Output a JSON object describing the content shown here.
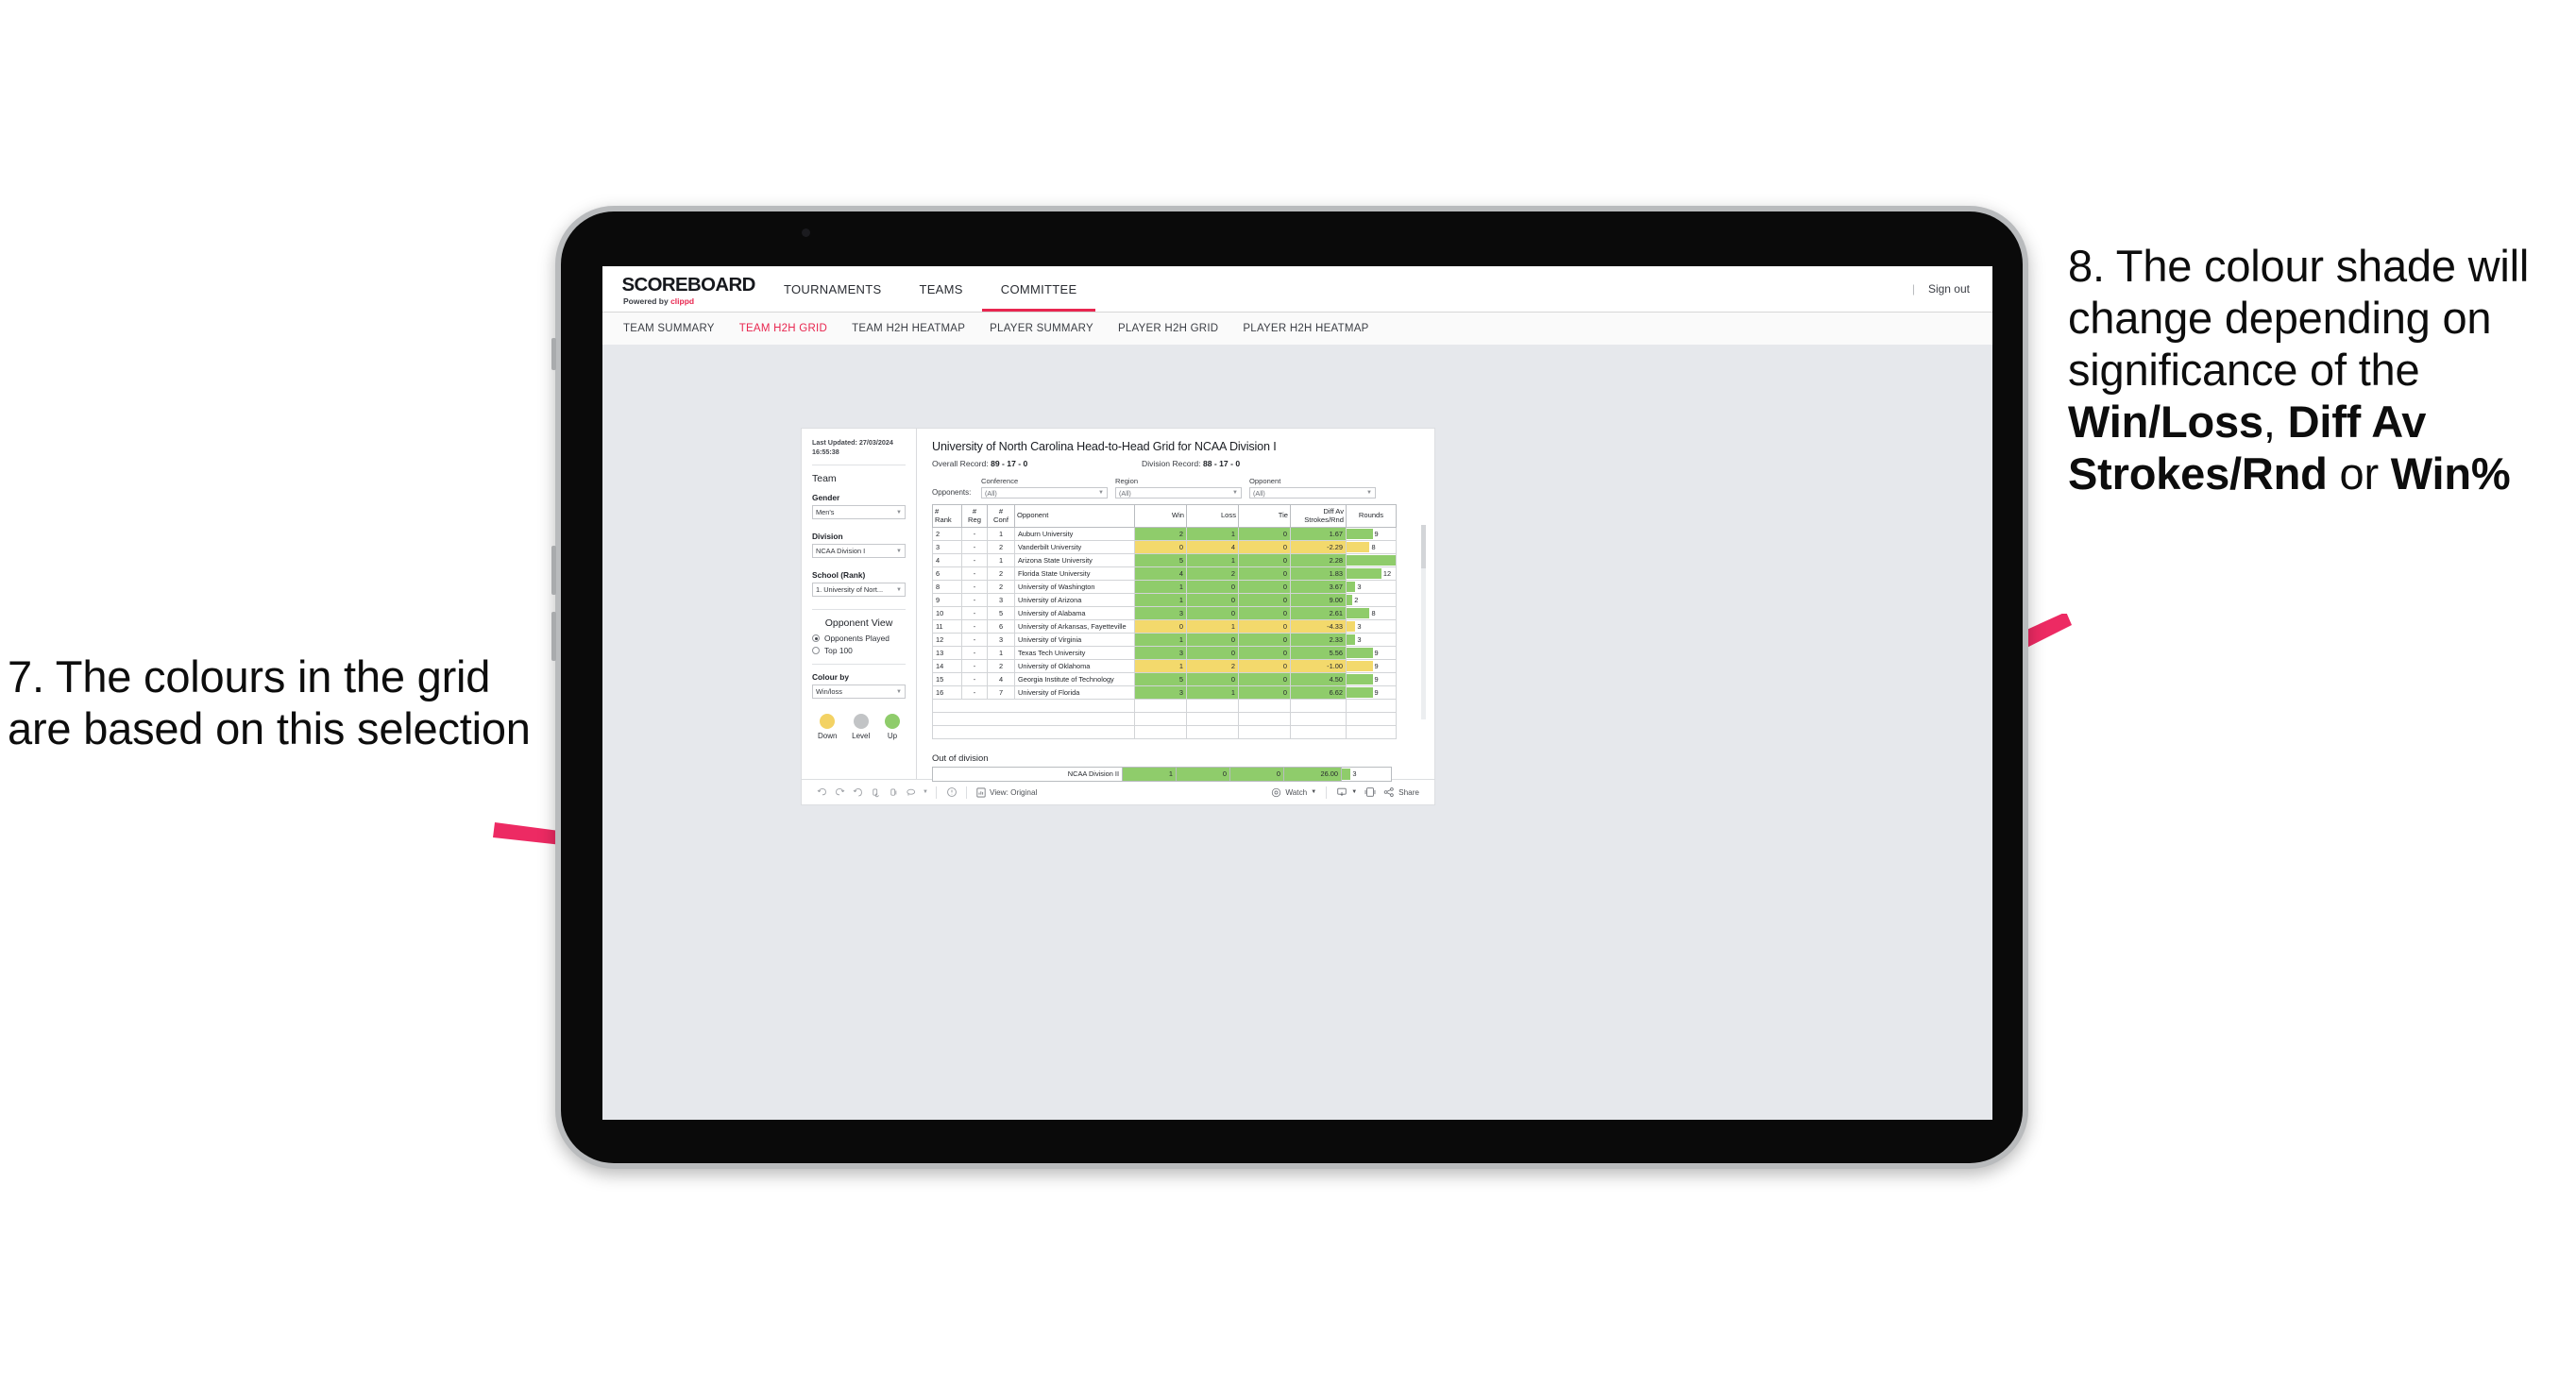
{
  "annotations": {
    "left": "7. The colours in the grid are based on this selection",
    "right_pre": "8. The colour shade will change depending on significance of the ",
    "right_b1": "Win/Loss",
    "right_mid1": ", ",
    "right_b2": "Diff Av Strokes/Rnd",
    "right_mid2": " or ",
    "right_b3": "Win%",
    "accent_color": "#ed2a63"
  },
  "topnav": {
    "brand_title": "SCOREBOARD",
    "brand_sub_prefix": "Powered by ",
    "brand_sub_name": "clippd",
    "items": [
      {
        "label": "TOURNAMENTS",
        "active": false
      },
      {
        "label": "TEAMS",
        "active": false
      },
      {
        "label": "COMMITTEE",
        "active": true
      }
    ],
    "separator": "|",
    "signout": "Sign out"
  },
  "subnav": {
    "items": [
      {
        "label": "TEAM SUMMARY",
        "active": false
      },
      {
        "label": "TEAM H2H GRID",
        "active": true
      },
      {
        "label": "TEAM H2H HEATMAP",
        "active": false
      },
      {
        "label": "PLAYER SUMMARY",
        "active": false
      },
      {
        "label": "PLAYER H2H GRID",
        "active": false
      },
      {
        "label": "PLAYER H2H HEATMAP",
        "active": false
      }
    ]
  },
  "sidebar": {
    "last_updated": "Last Updated: 27/03/2024 16:55:38",
    "team_heading": "Team",
    "gender_label": "Gender",
    "gender_value": "Men's",
    "division_label": "Division",
    "division_value": "NCAA Division I",
    "school_label": "School (Rank)",
    "school_value": "1. University of Nort...",
    "opponent_view_heading": "Opponent View",
    "opponent_view_options": [
      {
        "label": "Opponents Played",
        "selected": true
      },
      {
        "label": "Top 100",
        "selected": false
      }
    ],
    "colour_by_label": "Colour by",
    "colour_by_value": "Win/loss",
    "legend": [
      {
        "label": "Down",
        "color": "#f3d264"
      },
      {
        "label": "Level",
        "color": "#c2c4c6"
      },
      {
        "label": "Up",
        "color": "#8fcc6b"
      }
    ]
  },
  "main": {
    "title": "University of North Carolina Head-to-Head Grid for NCAA Division I",
    "overall_record_label": "Overall Record: ",
    "overall_record_value": "89 - 17 - 0",
    "division_record_label": "Division Record: ",
    "division_record_value": "88 - 17 - 0",
    "opponents_label": "Opponents:",
    "filters": [
      {
        "label": "Conference",
        "value": "(All)"
      },
      {
        "label": "Region",
        "value": "(All)"
      },
      {
        "label": "Opponent",
        "value": "(All)"
      }
    ],
    "columns": [
      "# Rank",
      "# Reg",
      "# Conf",
      "Opponent",
      "Win",
      "Loss",
      "Tie",
      "Diff Av Strokes/Rnd",
      "Rounds"
    ],
    "column_lines": [
      [
        "#",
        "Rank"
      ],
      [
        "#",
        "Reg"
      ],
      [
        "#",
        "Conf"
      ],
      [
        "Opponent"
      ],
      [
        "Win"
      ],
      [
        "Loss"
      ],
      [
        "Tie"
      ],
      [
        "Diff Av",
        "Strokes/Rnd"
      ],
      [
        "Rounds"
      ]
    ],
    "out_of_division_label": "Out of division"
  },
  "chart_data": {
    "type": "table",
    "title": "University of North Carolina Head-to-Head Grid for NCAA Division I",
    "colour_by": "Win/loss",
    "colour_scale": {
      "up": "#8fcc6b",
      "down": "#f3d96c",
      "level": "#c2c4c6"
    },
    "columns": [
      "#Rank",
      "#Reg",
      "#Conf",
      "Opponent",
      "Win",
      "Loss",
      "Tie",
      "Diff Av Strokes/Rnd",
      "Rounds"
    ],
    "rows": [
      {
        "rank": "2",
        "reg": "-",
        "conf": "1",
        "opponent": "Auburn University",
        "win": "2",
        "loss": "1",
        "tie": "0",
        "diff": "1.67",
        "rounds": 9,
        "color": "up"
      },
      {
        "rank": "3",
        "reg": "-",
        "conf": "2",
        "opponent": "Vanderbilt University",
        "win": "0",
        "loss": "4",
        "tie": "0",
        "diff": "-2.29",
        "rounds": 8,
        "color": "down"
      },
      {
        "rank": "4",
        "reg": "-",
        "conf": "1",
        "opponent": "Arizona State University",
        "win": "5",
        "loss": "1",
        "tie": "0",
        "diff": "2.28",
        "rounds": 17,
        "color": "up"
      },
      {
        "rank": "6",
        "reg": "-",
        "conf": "2",
        "opponent": "Florida State University",
        "win": "4",
        "loss": "2",
        "tie": "0",
        "diff": "1.83",
        "rounds": 12,
        "color": "up"
      },
      {
        "rank": "8",
        "reg": "-",
        "conf": "2",
        "opponent": "University of Washington",
        "win": "1",
        "loss": "0",
        "tie": "0",
        "diff": "3.67",
        "rounds": 3,
        "color": "up"
      },
      {
        "rank": "9",
        "reg": "-",
        "conf": "3",
        "opponent": "University of Arizona",
        "win": "1",
        "loss": "0",
        "tie": "0",
        "diff": "9.00",
        "rounds": 2,
        "color": "up"
      },
      {
        "rank": "10",
        "reg": "-",
        "conf": "5",
        "opponent": "University of Alabama",
        "win": "3",
        "loss": "0",
        "tie": "0",
        "diff": "2.61",
        "rounds": 8,
        "color": "up"
      },
      {
        "rank": "11",
        "reg": "-",
        "conf": "6",
        "opponent": "University of Arkansas, Fayetteville",
        "win": "0",
        "loss": "1",
        "tie": "0",
        "diff": "-4.33",
        "rounds": 3,
        "color": "down"
      },
      {
        "rank": "12",
        "reg": "-",
        "conf": "3",
        "opponent": "University of Virginia",
        "win": "1",
        "loss": "0",
        "tie": "0",
        "diff": "2.33",
        "rounds": 3,
        "color": "up"
      },
      {
        "rank": "13",
        "reg": "-",
        "conf": "1",
        "opponent": "Texas Tech University",
        "win": "3",
        "loss": "0",
        "tie": "0",
        "diff": "5.56",
        "rounds": 9,
        "color": "up"
      },
      {
        "rank": "14",
        "reg": "-",
        "conf": "2",
        "opponent": "University of Oklahoma",
        "win": "1",
        "loss": "2",
        "tie": "0",
        "diff": "-1.00",
        "rounds": 9,
        "color": "down"
      },
      {
        "rank": "15",
        "reg": "-",
        "conf": "4",
        "opponent": "Georgia Institute of Technology",
        "win": "5",
        "loss": "0",
        "tie": "0",
        "diff": "4.50",
        "rounds": 9,
        "color": "up"
      },
      {
        "rank": "16",
        "reg": "-",
        "conf": "7",
        "opponent": "University of Florida",
        "win": "3",
        "loss": "1",
        "tie": "0",
        "diff": "6.62",
        "rounds": 9,
        "color": "up"
      }
    ],
    "rounds_max": 17,
    "out_of_division": [
      {
        "opponent": "NCAA Division II",
        "win": "1",
        "loss": "0",
        "tie": "0",
        "diff": "26.00",
        "rounds": 3,
        "color": "up"
      }
    ]
  },
  "toolbar": {
    "icons": [
      "undo-icon",
      "redo-icon",
      "revert-icon",
      "refresh-icon",
      "pause-icon",
      "alerts-icon"
    ],
    "view_label": "View: Original",
    "watch_label": "Watch",
    "share_label": "Share"
  }
}
